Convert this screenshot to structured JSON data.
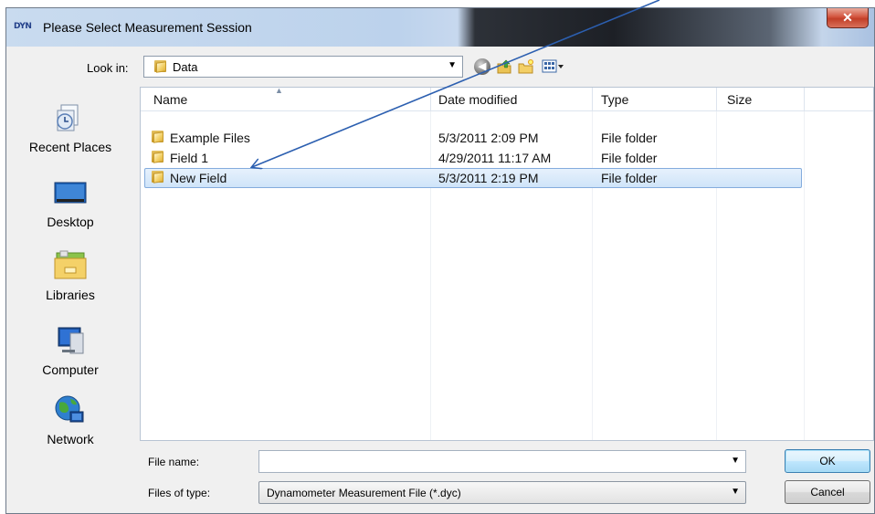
{
  "window": {
    "title": "Please Select Measurement Session",
    "icon_text": "DYN"
  },
  "toolbar": {
    "look_in_label": "Look in:",
    "look_in_value": "Data",
    "icons": [
      "back-icon",
      "up-folder-icon",
      "new-folder-icon",
      "views-menu-icon"
    ]
  },
  "places": [
    {
      "label": "Recent Places",
      "icon": "recent-places-icon"
    },
    {
      "label": "Desktop",
      "icon": "desktop-icon"
    },
    {
      "label": "Libraries",
      "icon": "libraries-icon"
    },
    {
      "label": "Computer",
      "icon": "computer-icon"
    },
    {
      "label": "Network",
      "icon": "network-icon"
    }
  ],
  "file_list": {
    "columns": [
      "Name",
      "Date modified",
      "Type",
      "Size"
    ],
    "rows": [
      {
        "name": "Example Files",
        "date": "5/3/2011 2:09 PM",
        "type": "File folder",
        "size": ""
      },
      {
        "name": "Field 1",
        "date": "4/29/2011 11:17 AM",
        "type": "File folder",
        "size": ""
      },
      {
        "name": "New Field",
        "date": "5/3/2011 2:19 PM",
        "type": "File folder",
        "size": "",
        "selected": true
      }
    ]
  },
  "footer": {
    "file_name_label": "File name:",
    "file_name_value": "",
    "files_of_type_label": "Files of type:",
    "files_of_type_value": "Dynamometer Measurement File (*.dyc)",
    "ok_label": "OK",
    "cancel_label": "Cancel"
  },
  "colors": {
    "selection": "#cfe4f9",
    "selection_border": "#84acdd",
    "annotation_arrow": "#2c5fb0"
  }
}
